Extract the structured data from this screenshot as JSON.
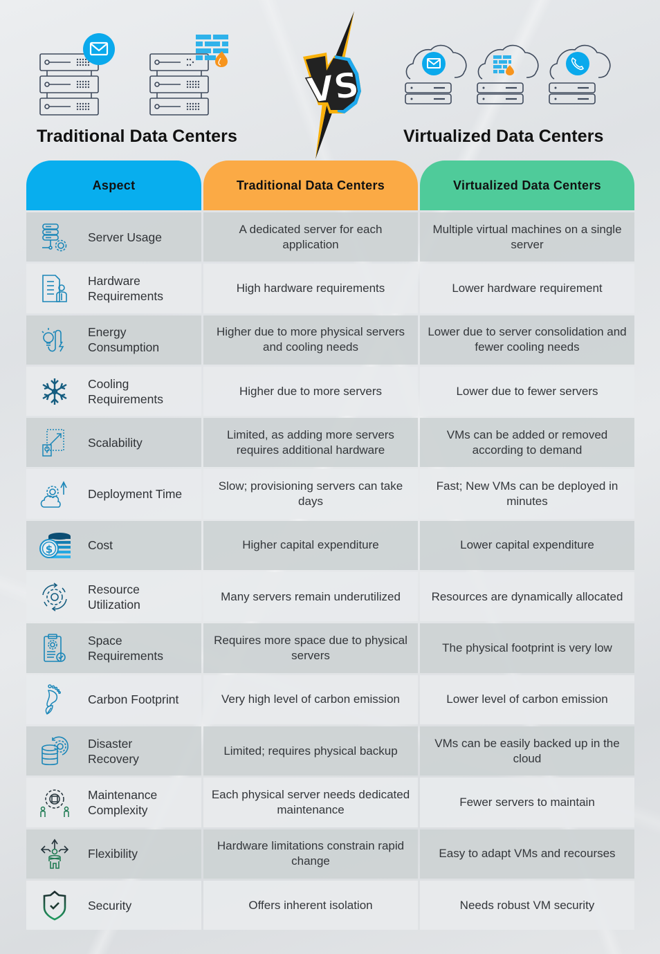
{
  "header": {
    "left_title": "Traditional Data Centers",
    "right_title": "Virtualized Data Centers",
    "vs_label": "VS",
    "left_icons": [
      "server-mail-icon",
      "server-firewall-icon"
    ],
    "right_icons": [
      "cloud-server-mail-icon",
      "cloud-server-firewall-icon",
      "cloud-server-phone-icon"
    ]
  },
  "colors": {
    "aspect_header": "#08aeee",
    "traditional_header": "#fbaa45",
    "virtualized_header": "#4fcb9a",
    "icon_blue": "#1a86b8",
    "icon_green": "#1e7a52"
  },
  "table": {
    "columns": [
      "Aspect",
      "Traditional Data Centers",
      "Virtualized Data Centers"
    ],
    "rows": [
      {
        "aspect": "Server Usage",
        "icon": "server-gear-icon",
        "traditional": "A dedicated server for each application",
        "virtualized": "Multiple virtual machines on a single server"
      },
      {
        "aspect": "Hardware Requirements",
        "icon": "checklist-person-icon",
        "traditional": "High hardware requirements",
        "virtualized": "Lower hardware requirement"
      },
      {
        "aspect": "Energy Consumption",
        "icon": "bulb-plug-icon",
        "traditional": "Higher due to more physical servers and cooling needs",
        "virtualized": "Lower due to server consolidation and fewer cooling needs"
      },
      {
        "aspect": "Cooling Requirements",
        "icon": "snowflake-icon",
        "traditional": "Higher due to more servers",
        "virtualized": "Lower due to fewer servers"
      },
      {
        "aspect": "Scalability",
        "icon": "scale-arrow-icon",
        "traditional": "Limited, as adding more servers requires additional hardware",
        "virtualized": "VMs can be added or removed according to demand"
      },
      {
        "aspect": "Deployment Time",
        "icon": "cloud-gear-upload-icon",
        "traditional": "Slow; provisioning servers can take days",
        "virtualized": "Fast; New VMs can be deployed in minutes"
      },
      {
        "aspect": "Cost",
        "icon": "dollar-coins-icon",
        "traditional": "Higher capital expenditure",
        "virtualized": "Lower capital expenditure"
      },
      {
        "aspect": "Resource Utilization",
        "icon": "gear-cycle-icon",
        "traditional": "Many servers remain underutilized",
        "virtualized": "Resources are dynamically allocated"
      },
      {
        "aspect": "Space Requirements",
        "icon": "clipboard-gear-check-icon",
        "traditional": "Requires more space due to physical servers",
        "virtualized": "The physical footprint is very low"
      },
      {
        "aspect": "Carbon Footprint",
        "icon": "footprint-leaf-icon",
        "traditional": "Very high level of carbon emission",
        "virtualized": "Lower level of carbon emission"
      },
      {
        "aspect": "Disaster Recovery",
        "icon": "database-gear-icon",
        "traditional": "Limited; requires physical backup",
        "virtualized": "VMs can be easily backed up in the cloud"
      },
      {
        "aspect": "Maintenance Complexity",
        "icon": "gear-people-icon",
        "traditional": "Each physical server needs dedicated maintenance",
        "virtualized": "Fewer servers to maintain"
      },
      {
        "aspect": "Flexibility",
        "icon": "person-arrows-icon",
        "traditional": "Hardware limitations constrain rapid change",
        "virtualized": "Easy to adapt VMs and recourses"
      },
      {
        "aspect": "Security",
        "icon": "shield-check-icon",
        "traditional": "Offers inherent isolation",
        "virtualized": "Needs robust VM security"
      }
    ]
  }
}
